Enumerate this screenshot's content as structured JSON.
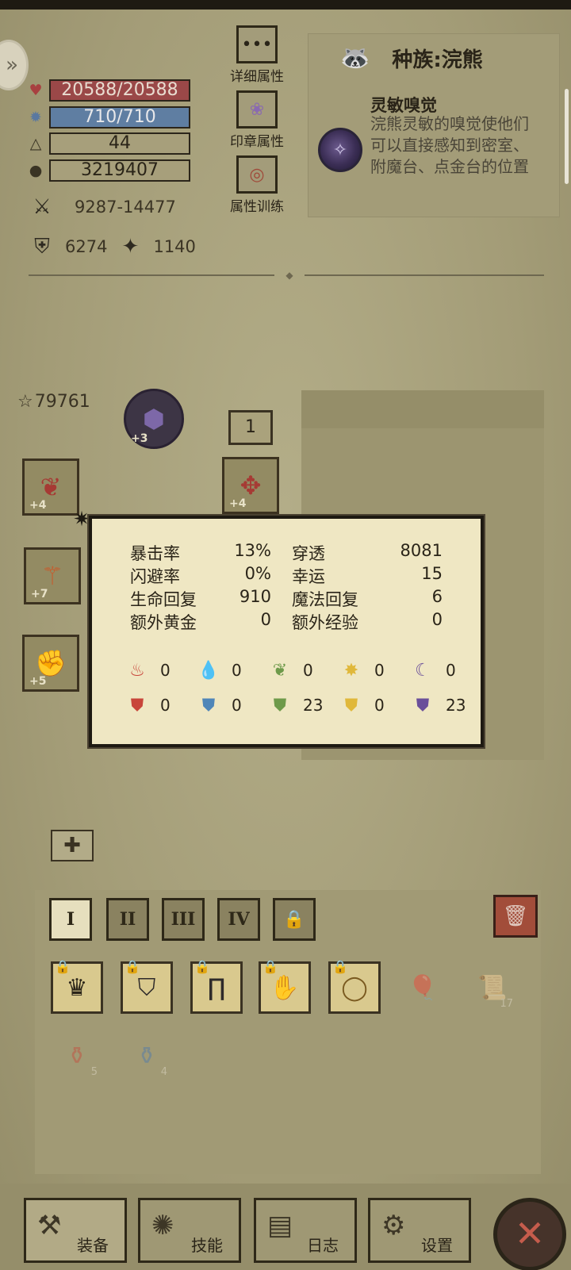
{
  "header": {
    "side_button_icon": "chevron-right-icon"
  },
  "stats": {
    "hp": "20588/20588",
    "mp": "710/710",
    "level": "44",
    "gold": "3219407",
    "attack": "9287-14477",
    "defense": "6274",
    "magic_resist": "1140"
  },
  "menu": {
    "detail_label": "详细属性",
    "seal_label": "印章属性",
    "train_label": "属性训练"
  },
  "race": {
    "title": "种族:浣熊",
    "ability_name": "灵敏嗅觉",
    "ability_desc": "浣熊灵敏的嗅觉使他们可以直接感知到密室、附魔台、点金台的位置"
  },
  "equipment": {
    "score": "79761",
    "level_box": "1",
    "slots": {
      "helmet_plus": "+3",
      "left1_plus": "+4",
      "right1_plus": "+4",
      "weapon_plus": "+7",
      "gloves_plus": "+5"
    }
  },
  "tooltip": {
    "rows": [
      {
        "k1": "暴击率",
        "v1": "13%",
        "k2": "穿透",
        "v2": "8081"
      },
      {
        "k1": "闪避率",
        "v1": "0%",
        "k2": "幸运",
        "v2": "15"
      },
      {
        "k1": "生命回复",
        "v1": "910",
        "k2": "魔法回复",
        "v2": "6"
      },
      {
        "k1": "额外黄金",
        "v1": "0",
        "k2": "额外经验",
        "v2": "0"
      }
    ],
    "attack_elements": [
      "0",
      "0",
      "0",
      "0",
      "0"
    ],
    "resist_elements": [
      "0",
      "0",
      "23",
      "0",
      "23"
    ]
  },
  "inventory": {
    "tabs": [
      "I",
      "II",
      "III",
      "IV"
    ],
    "counts": {
      "scroll": "17",
      "potion_red": "5",
      "potion_blue": "4"
    }
  },
  "nav": {
    "equip": "装备",
    "skills": "技能",
    "log": "日志",
    "settings": "设置"
  },
  "colors": {
    "hp_bar": "#9a4848",
    "mp_bar": "#5f7ea2",
    "tooltip_bg": "#efe7c3",
    "fire": "#c8453a",
    "water": "#4f86b8",
    "nature": "#6e9a4a",
    "light": "#e0b83a",
    "dark": "#6a4f9a"
  }
}
